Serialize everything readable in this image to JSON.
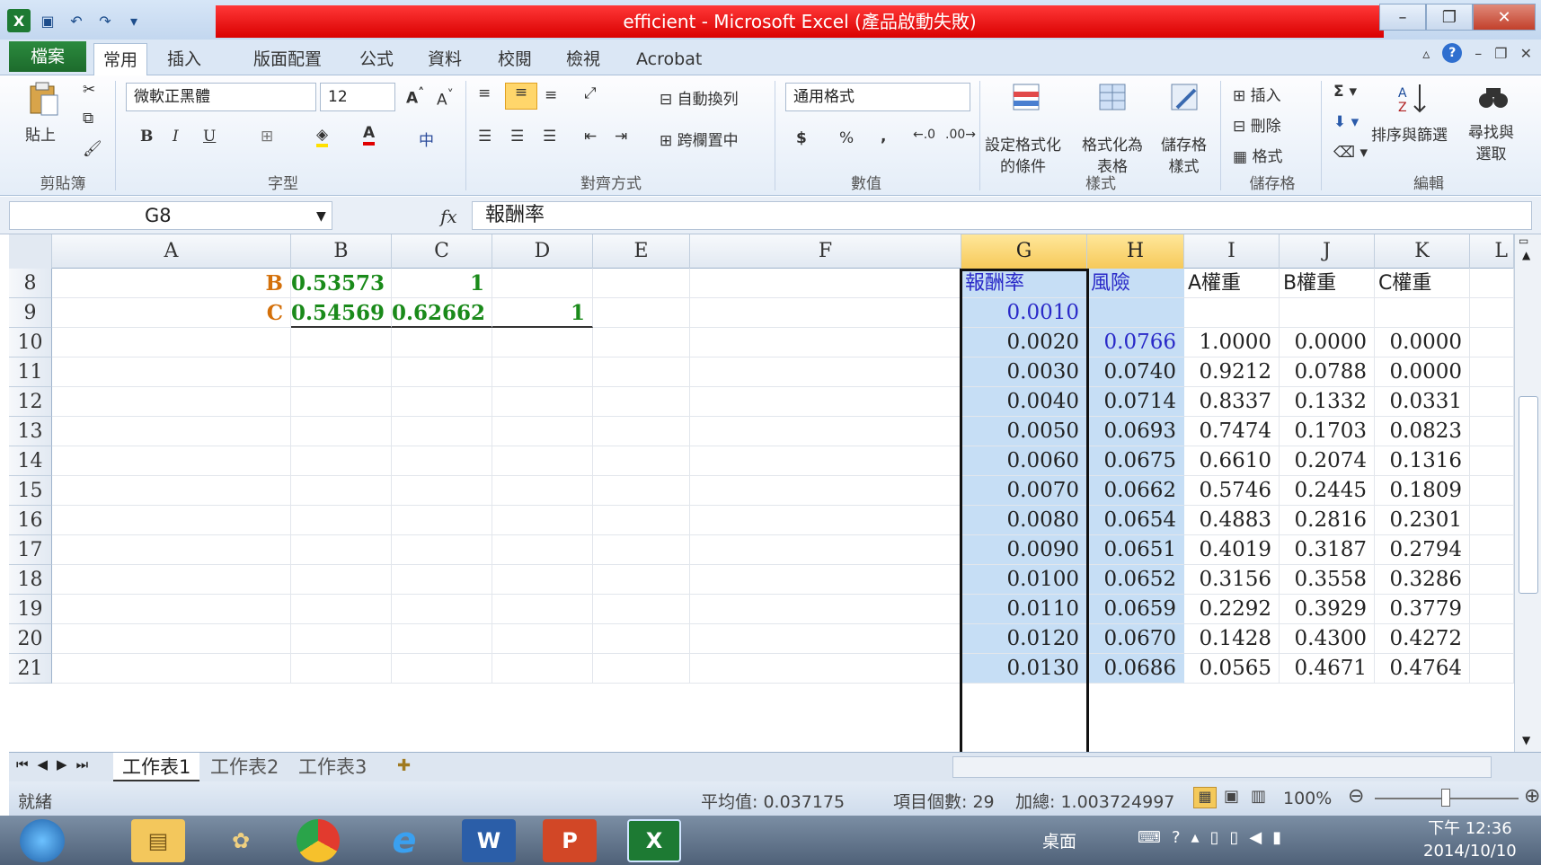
{
  "window": {
    "title": "efficient - Microsoft Excel (產品啟動失敗)"
  },
  "ribbon_tabs": [
    "檔案",
    "常用",
    "插入",
    "版面配置",
    "公式",
    "資料",
    "校閱",
    "檢視",
    "Acrobat"
  ],
  "ribbon": {
    "paste": "貼上",
    "clipboard_group": "剪貼簿",
    "font_name": "微軟正黑體",
    "font_size": "12",
    "font_group": "字型",
    "wrap_text": "自動換列",
    "merge_center": "跨欄置中",
    "alignment_group": "對齊方式",
    "number_format": "通用格式",
    "number_group": "數值",
    "cond_format_l1": "設定格式化",
    "cond_format_l2": "的條件",
    "format_table_l1": "格式化為",
    "format_table_l2": "表格",
    "cell_styles_l1": "儲存格",
    "cell_styles_l2": "樣式",
    "styles_group": "樣式",
    "insert": "插入",
    "delete": "刪除",
    "format": "格式",
    "cells_group": "儲存格",
    "sort_filter": "排序與篩選",
    "find_select_l1": "尋找與",
    "find_select_l2": "選取",
    "editing_group": "編輯",
    "bold": "B",
    "italic": "I",
    "underline": "U",
    "currency": "$",
    "percent": "%",
    "comma": ","
  },
  "formula_bar": {
    "name_box": "G8",
    "fx": "fx",
    "value": "報酬率"
  },
  "columns": [
    "A",
    "B",
    "C",
    "D",
    "E",
    "F",
    "G",
    "H",
    "I",
    "J",
    "K",
    "L"
  ],
  "rows": [
    {
      "num": "8",
      "A": "",
      "B_label": "B",
      "B": "0.53573",
      "C": "1",
      "D": "",
      "G": "報酬率",
      "H": "風險",
      "I": "A權重",
      "J": "B權重",
      "K": "C權重"
    },
    {
      "num": "9",
      "A": "",
      "B_label": "C",
      "B": "0.54569",
      "C": "0.62662",
      "D": "1",
      "G": "0.0010",
      "H": "",
      "I": "",
      "J": "",
      "K": ""
    },
    {
      "num": "10",
      "G": "0.0020",
      "H": "0.0766",
      "I": "1.0000",
      "J": "0.0000",
      "K": "0.0000"
    },
    {
      "num": "11",
      "G": "0.0030",
      "H": "0.0740",
      "I": "0.9212",
      "J": "0.0788",
      "K": "0.0000"
    },
    {
      "num": "12",
      "G": "0.0040",
      "H": "0.0714",
      "I": "0.8337",
      "J": "0.1332",
      "K": "0.0331"
    },
    {
      "num": "13",
      "G": "0.0050",
      "H": "0.0693",
      "I": "0.7474",
      "J": "0.1703",
      "K": "0.0823"
    },
    {
      "num": "14",
      "G": "0.0060",
      "H": "0.0675",
      "I": "0.6610",
      "J": "0.2074",
      "K": "0.1316"
    },
    {
      "num": "15",
      "G": "0.0070",
      "H": "0.0662",
      "I": "0.5746",
      "J": "0.2445",
      "K": "0.1809"
    },
    {
      "num": "16",
      "G": "0.0080",
      "H": "0.0654",
      "I": "0.4883",
      "J": "0.2816",
      "K": "0.2301"
    },
    {
      "num": "17",
      "G": "0.0090",
      "H": "0.0651",
      "I": "0.4019",
      "J": "0.3187",
      "K": "0.2794"
    },
    {
      "num": "18",
      "G": "0.0100",
      "H": "0.0652",
      "I": "0.3156",
      "J": "0.3558",
      "K": "0.3286"
    },
    {
      "num": "19",
      "G": "0.0110",
      "H": "0.0659",
      "I": "0.2292",
      "J": "0.3929",
      "K": "0.3779"
    },
    {
      "num": "20",
      "G": "0.0120",
      "H": "0.0670",
      "I": "0.1428",
      "J": "0.4300",
      "K": "0.4272"
    },
    {
      "num": "21",
      "G": "0.0130",
      "H": "0.0686",
      "I": "0.0565",
      "J": "0.4671",
      "K": "0.4764"
    }
  ],
  "sheet_tabs": [
    "工作表1",
    "工作表2",
    "工作表3"
  ],
  "status": {
    "ready": "就緒",
    "average": "平均值: 0.037175",
    "count": "項目個數: 29",
    "sum": "加總: 1.003724997",
    "zoom": "100%"
  },
  "taskbar": {
    "desktop": "桌面",
    "time": "下午 12:36",
    "date": "2014/10/10"
  }
}
